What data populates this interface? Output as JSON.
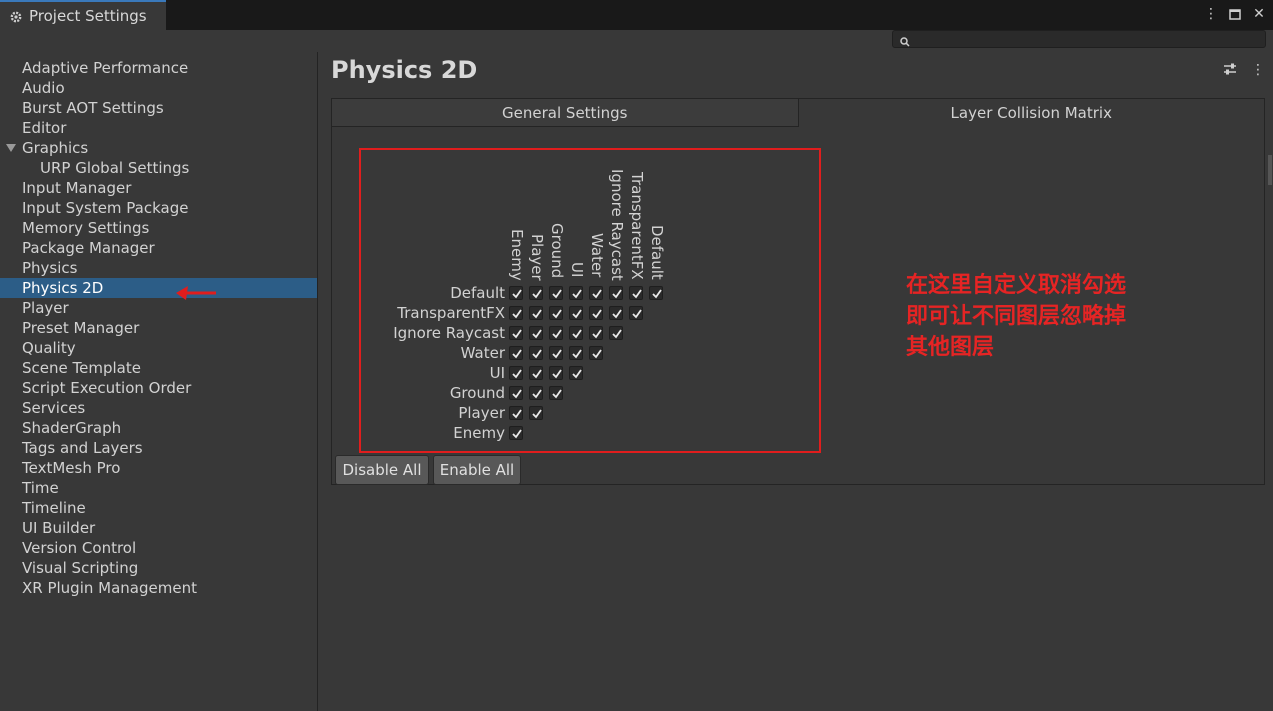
{
  "window": {
    "tab_title": "Project Settings",
    "controls": [
      "more-icon",
      "maximize-icon",
      "close-icon"
    ]
  },
  "search": {
    "placeholder": "",
    "value": ""
  },
  "sidebar": {
    "items": [
      {
        "label": "Adaptive Performance"
      },
      {
        "label": "Audio"
      },
      {
        "label": "Burst AOT Settings"
      },
      {
        "label": "Editor"
      },
      {
        "label": "Graphics",
        "expanded": true
      },
      {
        "label": "URP Global Settings",
        "child": true
      },
      {
        "label": "Input Manager"
      },
      {
        "label": "Input System Package"
      },
      {
        "label": "Memory Settings"
      },
      {
        "label": "Package Manager"
      },
      {
        "label": "Physics"
      },
      {
        "label": "Physics 2D",
        "selected": true
      },
      {
        "label": "Player"
      },
      {
        "label": "Preset Manager"
      },
      {
        "label": "Quality"
      },
      {
        "label": "Scene Template"
      },
      {
        "label": "Script Execution Order"
      },
      {
        "label": "Services"
      },
      {
        "label": "ShaderGraph"
      },
      {
        "label": "Tags and Layers"
      },
      {
        "label": "TextMesh Pro"
      },
      {
        "label": "Time"
      },
      {
        "label": "Timeline"
      },
      {
        "label": "UI Builder"
      },
      {
        "label": "Version Control"
      },
      {
        "label": "Visual Scripting"
      },
      {
        "label": "XR Plugin Management"
      }
    ]
  },
  "main": {
    "title": "Physics 2D",
    "tabs": [
      {
        "label": "General Settings",
        "active": false
      },
      {
        "label": "Layer Collision Matrix",
        "active": true
      }
    ],
    "matrix": {
      "columns": [
        "Enemy",
        "Player",
        "Ground",
        "UI",
        "Water",
        "Ignore Raycast",
        "TransparentFX",
        "Default"
      ],
      "rows": [
        "Default",
        "TransparentFX",
        "Ignore Raycast",
        "Water",
        "UI",
        "Ground",
        "Player",
        "Enemy"
      ],
      "all_checked": true
    },
    "buttons": {
      "disable_all": "Disable All",
      "enable_all": "Enable All"
    }
  },
  "annotation": {
    "line1": "在这里自定义取消勾选",
    "line2": "即可让不同图层忽略掉",
    "line3": "其他图层",
    "color": "#e62424"
  },
  "colors": {
    "selection": "#2c5d87",
    "tab_accent": "#3a79bb",
    "highlight_box": "#e01d1d"
  }
}
